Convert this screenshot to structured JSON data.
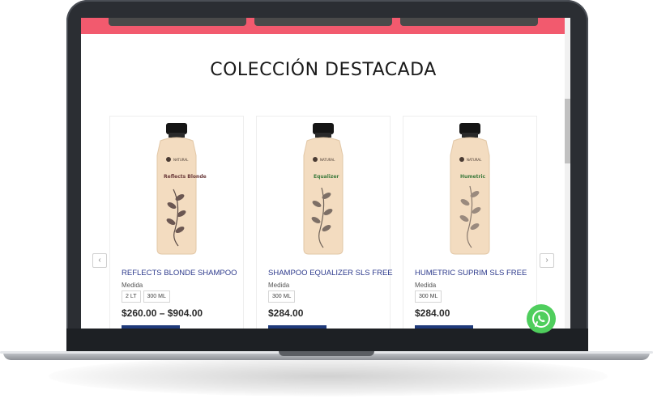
{
  "section": {
    "title": "COLECCIÓN DESTACADA"
  },
  "products": [
    {
      "name": "REFLECTS BLONDE SHAMPOO",
      "variant_label": "Medida",
      "options": [
        "2 LT",
        "300 ML"
      ],
      "price": "$260.00 – $904.00",
      "bottle_label": "Reflects Blonde"
    },
    {
      "name": "SHAMPOO EQUALIZER SLS FREE",
      "variant_label": "Medida",
      "options": [
        "300 ML"
      ],
      "price": "$284.00",
      "bottle_label": "Equalizer"
    },
    {
      "name": "HUMETRIC SUPRIM SLS FREE",
      "variant_label": "Medida",
      "options": [
        "300 ML"
      ],
      "price": "$284.00",
      "bottle_label": "Humetric"
    }
  ],
  "carousel": {
    "prev_icon": "‹",
    "next_icon": "›"
  },
  "colors": {
    "banner": "#f25a6e",
    "title": "#2d3a8c",
    "button": "#1f3a7a",
    "whatsapp": "#4fce5d"
  },
  "icons": {
    "whatsapp": "whatsapp-icon",
    "prev": "chevron-left-icon",
    "next": "chevron-right-icon"
  }
}
